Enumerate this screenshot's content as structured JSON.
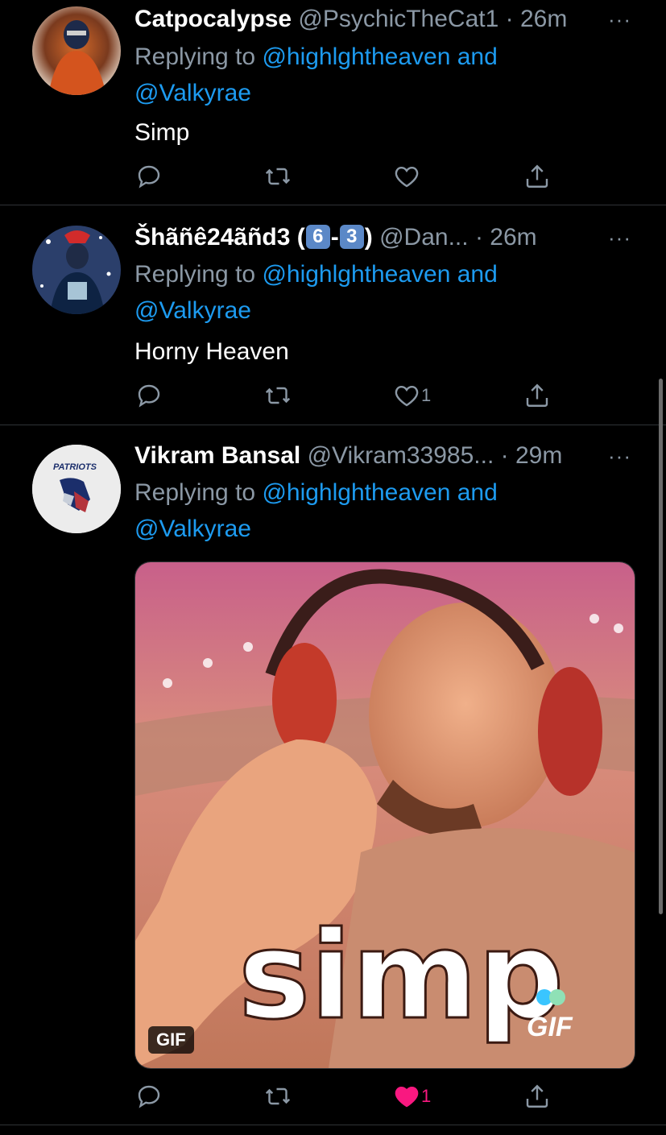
{
  "tweets": [
    {
      "name": "Catpocalypse",
      "handle": "@PsychicTheCat1",
      "time": "· 26m",
      "replying_prefix": "Replying to ",
      "replying_user1": "@highlghtheaven",
      "replying_and": " and",
      "replying_user2": "@Valkyrae",
      "text": "Simp",
      "like_count": ""
    },
    {
      "name_prefix": "Šhãñê24ãñd3 (",
      "key1": "6",
      "dash": "-",
      "key2": "3",
      "name_suffix": ")",
      "handle": "@Dan...",
      "time": "· 26m",
      "replying_prefix": "Replying to ",
      "replying_user1": "@highlghtheaven",
      "replying_and": " and",
      "replying_user2": "@Valkyrae",
      "text": "Horny Heaven",
      "like_count": "1"
    },
    {
      "name": "Vikram Bansal",
      "handle": "@Vikram33985...",
      "time": "· 29m",
      "replying_prefix": "Replying to ",
      "replying_user1": "@highlghtheaven",
      "replying_and": " and",
      "replying_user2": "@Valkyrae",
      "avatar_text": "PATRIOTS",
      "media": {
        "caption": "simp",
        "watermark": "GIF",
        "badge": "GIF"
      },
      "like_count": "1",
      "liked": true
    }
  ],
  "more_label": "···",
  "colors": {
    "background": "#000000",
    "link": "#1d9bf0",
    "secondary": "#8b98a5",
    "like_active": "#f91880"
  },
  "icons": [
    "reply-icon",
    "retweet-icon",
    "like-icon",
    "share-icon",
    "more-icon"
  ]
}
